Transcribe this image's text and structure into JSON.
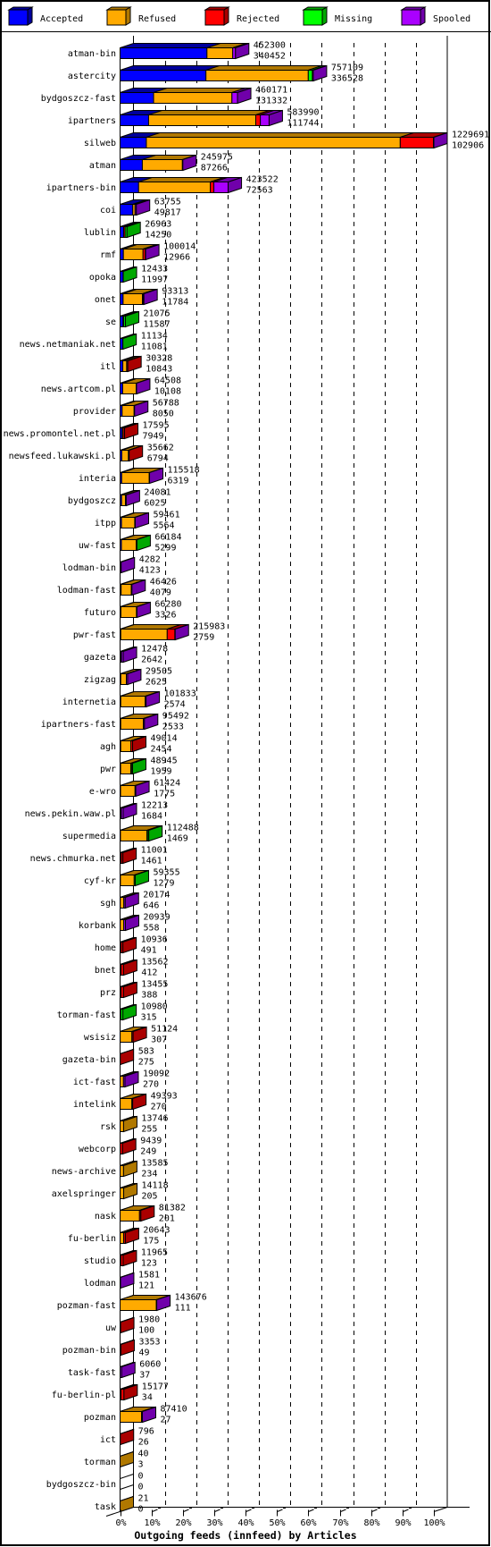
{
  "chart_data": {
    "type": "bar",
    "orientation": "horizontal",
    "stacked": true,
    "style": "3d",
    "title": "",
    "xlabel": "Outgoing feeds (innfeed) by Articles",
    "ylabel": "",
    "xlim": [
      0,
      100
    ],
    "x_unit": "percent of largest feed total",
    "x_ticks": [
      "0%",
      "10%",
      "20%",
      "30%",
      "40%",
      "50%",
      "60%",
      "70%",
      "80%",
      "90%",
      "100%"
    ],
    "grid": "vertical dashed at each 10%",
    "legend_position": "top",
    "value_labels": "two per bar: total articles (top), accepted articles (bottom)",
    "legend": [
      {
        "key": "accepted",
        "label": "Accepted",
        "color": "#0000ff",
        "shade": "#00009c"
      },
      {
        "key": "refused",
        "label": "Refused",
        "color": "#ffaa00",
        "shade": "#b07800"
      },
      {
        "key": "rejected",
        "label": "Rejected",
        "color": "#ff0000",
        "shade": "#aa0000"
      },
      {
        "key": "missing",
        "label": "Missing",
        "color": "#00ff00",
        "shade": "#00a800"
      },
      {
        "key": "spooled",
        "label": "Spooled",
        "color": "#aa00ff",
        "shade": "#7000aa"
      }
    ],
    "rows": [
      {
        "name": "atman-bin",
        "total": 452300,
        "accepted": 340452,
        "refused": 101000,
        "rejected": 0,
        "missing": 0,
        "spooled": 10848
      },
      {
        "name": "astercity",
        "total": 757109,
        "accepted": 336528,
        "refused": 401000,
        "rejected": 0,
        "missing": 16000,
        "spooled": 3581
      },
      {
        "name": "bydgoszcz-fast",
        "total": 460171,
        "accepted": 131332,
        "refused": 307000,
        "rejected": 0,
        "missing": 0,
        "spooled": 21839
      },
      {
        "name": "ipartners",
        "total": 583990,
        "accepted": 111744,
        "refused": 420000,
        "rejected": 18000,
        "missing": 0,
        "spooled": 34246
      },
      {
        "name": "silweb",
        "total": 1229691,
        "accepted": 102906,
        "refused": 995000,
        "rejected": 130000,
        "missing": 0,
        "spooled": 1785
      },
      {
        "name": "atman",
        "total": 245975,
        "accepted": 87266,
        "refused": 157000,
        "rejected": 0,
        "missing": 0,
        "spooled": 1709
      },
      {
        "name": "ipartners-bin",
        "total": 423522,
        "accepted": 72563,
        "refused": 281000,
        "rejected": 14000,
        "missing": 0,
        "spooled": 55959
      },
      {
        "name": "coi",
        "total": 63755,
        "accepted": 49817,
        "refused": 8900,
        "rejected": 0,
        "missing": 0,
        "spooled": 5038
      },
      {
        "name": "lublin",
        "total": 26963,
        "accepted": 14250,
        "refused": 0,
        "rejected": 5500,
        "missing": 7213,
        "spooled": 0
      },
      {
        "name": "rmf",
        "total": 100014,
        "accepted": 12966,
        "refused": 77000,
        "rejected": 9000,
        "missing": 0,
        "spooled": 1048
      },
      {
        "name": "opoka",
        "total": 12433,
        "accepted": 11997,
        "refused": 0,
        "rejected": 0,
        "missing": 436,
        "spooled": 0
      },
      {
        "name": "onet",
        "total": 93313,
        "accepted": 11784,
        "refused": 76000,
        "rejected": 3000,
        "missing": 0,
        "spooled": 2529
      },
      {
        "name": "se",
        "total": 21075,
        "accepted": 11587,
        "refused": 0,
        "rejected": 3000,
        "missing": 6488,
        "spooled": 0
      },
      {
        "name": "news.netmaniak.net",
        "total": 11134,
        "accepted": 11081,
        "refused": 0,
        "rejected": 0,
        "missing": 53,
        "spooled": 0
      },
      {
        "name": "itl",
        "total": 30328,
        "accepted": 10843,
        "refused": 15000,
        "rejected": 4485,
        "missing": 0,
        "spooled": 0
      },
      {
        "name": "news.artcom.pl",
        "total": 64508,
        "accepted": 10108,
        "refused": 53000,
        "rejected": 0,
        "missing": 0,
        "spooled": 1400
      },
      {
        "name": "provider",
        "total": 56788,
        "accepted": 8050,
        "refused": 47000,
        "rejected": 0,
        "missing": 0,
        "spooled": 1738
      },
      {
        "name": "news.promontel.net.pl",
        "total": 17595,
        "accepted": 7949,
        "refused": 4000,
        "rejected": 5646,
        "missing": 0,
        "spooled": 0
      },
      {
        "name": "newsfeed.lukawski.pl",
        "total": 35662,
        "accepted": 6794,
        "refused": 26000,
        "rejected": 2868,
        "missing": 0,
        "spooled": 0
      },
      {
        "name": "interia",
        "total": 115518,
        "accepted": 6319,
        "refused": 108000,
        "rejected": 0,
        "missing": 0,
        "spooled": 1199
      },
      {
        "name": "bydgoszcz",
        "total": 24081,
        "accepted": 6025,
        "refused": 15000,
        "rejected": 0,
        "missing": 0,
        "spooled": 3056
      },
      {
        "name": "itpp",
        "total": 59461,
        "accepted": 5564,
        "refused": 52000,
        "rejected": 0,
        "missing": 0,
        "spooled": 1897
      },
      {
        "name": "uw-fast",
        "total": 66184,
        "accepted": 5299,
        "refused": 58000,
        "rejected": 0,
        "missing": 2885,
        "spooled": 0
      },
      {
        "name": "lodman-bin",
        "total": 4282,
        "accepted": 4123,
        "refused": 0,
        "rejected": 0,
        "missing": 0,
        "spooled": 159
      },
      {
        "name": "lodman-fast",
        "total": 46426,
        "accepted": 4079,
        "refused": 40000,
        "rejected": 0,
        "missing": 0,
        "spooled": 2347
      },
      {
        "name": "futuro",
        "total": 66280,
        "accepted": 3326,
        "refused": 61000,
        "rejected": 0,
        "missing": 0,
        "spooled": 1954
      },
      {
        "name": "pwr-fast",
        "total": 215983,
        "accepted": 2759,
        "refused": 182000,
        "rejected": 30000,
        "missing": 0,
        "spooled": 1224
      },
      {
        "name": "gazeta",
        "total": 12478,
        "accepted": 2642,
        "refused": 3000,
        "rejected": 0,
        "missing": 0,
        "spooled": 6836
      },
      {
        "name": "zigzag",
        "total": 29505,
        "accepted": 2625,
        "refused": 22000,
        "rejected": 0,
        "missing": 0,
        "spooled": 4880
      },
      {
        "name": "internetia",
        "total": 101833,
        "accepted": 2574,
        "refused": 96000,
        "rejected": 0,
        "missing": 0,
        "spooled": 3259
      },
      {
        "name": "ipartners-fast",
        "total": 95492,
        "accepted": 2533,
        "refused": 89000,
        "rejected": 0,
        "missing": 0,
        "spooled": 3959
      },
      {
        "name": "agh",
        "total": 49014,
        "accepted": 2454,
        "refused": 40000,
        "rejected": 6560,
        "missing": 0,
        "spooled": 0
      },
      {
        "name": "pwr",
        "total": 48945,
        "accepted": 1959,
        "refused": 40000,
        "rejected": 3000,
        "missing": 3986,
        "spooled": 0
      },
      {
        "name": "e-wro",
        "total": 61424,
        "accepted": 1775,
        "refused": 57000,
        "rejected": 0,
        "missing": 0,
        "spooled": 2649
      },
      {
        "name": "news.pekin.waw.pl",
        "total": 12213,
        "accepted": 1684,
        "refused": 3500,
        "rejected": 0,
        "missing": 0,
        "spooled": 7029
      },
      {
        "name": "supermedia",
        "total": 112488,
        "accepted": 1469,
        "refused": 104000,
        "rejected": 2000,
        "missing": 5019,
        "spooled": 0
      },
      {
        "name": "news.chmurka.net",
        "total": 11001,
        "accepted": 1461,
        "refused": 3000,
        "rejected": 6540,
        "missing": 0,
        "spooled": 0
      },
      {
        "name": "cyf-kr",
        "total": 59355,
        "accepted": 1279,
        "refused": 54000,
        "rejected": 0,
        "missing": 4076,
        "spooled": 0
      },
      {
        "name": "sgh",
        "total": 20174,
        "accepted": 646,
        "refused": 14000,
        "rejected": 0,
        "missing": 0,
        "spooled": 5528
      },
      {
        "name": "korbank",
        "total": 20939,
        "accepted": 558,
        "refused": 14000,
        "rejected": 0,
        "missing": 0,
        "spooled": 6381
      },
      {
        "name": "home",
        "total": 10936,
        "accepted": 491,
        "refused": 3500,
        "rejected": 6945,
        "missing": 0,
        "spooled": 0
      },
      {
        "name": "bnet",
        "total": 13562,
        "accepted": 412,
        "refused": 3500,
        "rejected": 9650,
        "missing": 0,
        "spooled": 0
      },
      {
        "name": "prz",
        "total": 13455,
        "accepted": 388,
        "refused": 3500,
        "rejected": 9567,
        "missing": 0,
        "spooled": 0
      },
      {
        "name": "torman-fast",
        "total": 10980,
        "accepted": 315,
        "refused": 3000,
        "rejected": 0,
        "missing": 7665,
        "spooled": 0
      },
      {
        "name": "wsisiz",
        "total": 51124,
        "accepted": 307,
        "refused": 46000,
        "rejected": 4817,
        "missing": 0,
        "spooled": 0
      },
      {
        "name": "gazeta-bin",
        "total": 583,
        "accepted": 275,
        "refused": 0,
        "rejected": 308,
        "missing": 0,
        "spooled": 0
      },
      {
        "name": "ict-fast",
        "total": 19092,
        "accepted": 270,
        "refused": 13000,
        "rejected": 0,
        "missing": 0,
        "spooled": 5822
      },
      {
        "name": "intelink",
        "total": 49393,
        "accepted": 270,
        "refused": 46000,
        "rejected": 3123,
        "missing": 0,
        "spooled": 0
      },
      {
        "name": "rsk",
        "total": 13746,
        "accepted": 255,
        "refused": 13491,
        "rejected": 0,
        "missing": 0,
        "spooled": 0
      },
      {
        "name": "webcorp",
        "total": 9439,
        "accepted": 249,
        "refused": 0,
        "rejected": 9190,
        "missing": 0,
        "spooled": 0
      },
      {
        "name": "news-archive",
        "total": 13585,
        "accepted": 234,
        "refused": 13351,
        "rejected": 0,
        "missing": 0,
        "spooled": 0
      },
      {
        "name": "axelspringer",
        "total": 14118,
        "accepted": 205,
        "refused": 13913,
        "rejected": 0,
        "missing": 0,
        "spooled": 0
      },
      {
        "name": "nask",
        "total": 81382,
        "accepted": 201,
        "refused": 76000,
        "rejected": 5181,
        "missing": 0,
        "spooled": 0
      },
      {
        "name": "fu-berlin",
        "total": 20643,
        "accepted": 175,
        "refused": 14000,
        "rejected": 6468,
        "missing": 0,
        "spooled": 0
      },
      {
        "name": "studio",
        "total": 11965,
        "accepted": 123,
        "refused": 3000,
        "rejected": 8842,
        "missing": 0,
        "spooled": 0
      },
      {
        "name": "lodman",
        "total": 1581,
        "accepted": 121,
        "refused": 0,
        "rejected": 0,
        "missing": 0,
        "spooled": 1460
      },
      {
        "name": "pozman-fast",
        "total": 143676,
        "accepted": 111,
        "refused": 142000,
        "rejected": 0,
        "missing": 0,
        "spooled": 1565
      },
      {
        "name": "uw",
        "total": 1980,
        "accepted": 100,
        "refused": 0,
        "rejected": 1880,
        "missing": 0,
        "spooled": 0
      },
      {
        "name": "pozman-bin",
        "total": 3353,
        "accepted": 49,
        "refused": 0,
        "rejected": 3304,
        "missing": 0,
        "spooled": 0
      },
      {
        "name": "task-fast",
        "total": 6060,
        "accepted": 37,
        "refused": 0,
        "rejected": 0,
        "missing": 0,
        "spooled": 6023
      },
      {
        "name": "fu-berlin-pl",
        "total": 15177,
        "accepted": 34,
        "refused": 4000,
        "rejected": 11143,
        "missing": 0,
        "spooled": 0
      },
      {
        "name": "pozman",
        "total": 87410,
        "accepted": 27,
        "refused": 84000,
        "rejected": 0,
        "missing": 0,
        "spooled": 3383
      },
      {
        "name": "ict",
        "total": 796,
        "accepted": 26,
        "refused": 0,
        "rejected": 770,
        "missing": 0,
        "spooled": 0
      },
      {
        "name": "torman",
        "total": 40,
        "accepted": 3,
        "refused": 37,
        "rejected": 0,
        "missing": 0,
        "spooled": 0
      },
      {
        "name": "bydgoszcz-bin",
        "total": 0,
        "accepted": 0,
        "refused": 0,
        "rejected": 0,
        "missing": 0,
        "spooled": 0
      },
      {
        "name": "task",
        "total": 21,
        "accepted": 0,
        "refused": 21,
        "rejected": 0,
        "missing": 0,
        "spooled": 0
      }
    ]
  }
}
